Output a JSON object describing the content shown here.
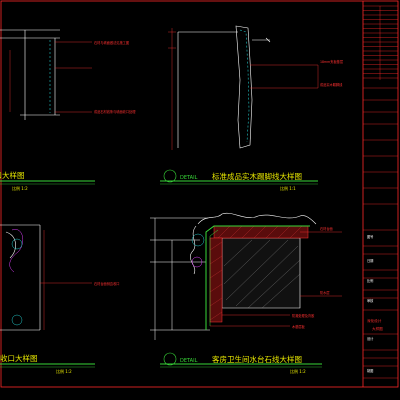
{
  "colors": {
    "background": "#000000",
    "frame": "#ff2a2a",
    "line": "#ffffff",
    "cyan": "#22c8c8",
    "green": "#38d838",
    "yellow": "#e8e800",
    "magenta": "#e040ff",
    "annotation": "#ff3030",
    "hatch_red": "#c83232"
  },
  "details": [
    {
      "title": "石材收口大样图",
      "scale": "比例  1:2"
    },
    {
      "badge": "DETAIL",
      "title": "标准成品实木踢脚线大样图",
      "scale": "比例  1:1"
    },
    {
      "title": "台面石材收口大样图",
      "scale": "比例  1:2"
    },
    {
      "badge": "DETAIL",
      "title": "客房卫生间水台石线大样图",
      "scale": "比例  1:2"
    }
  ],
  "annotations": {
    "top_left": [
      "石材与墙面做法见施工图",
      "成品石材线条与墙面收口处理"
    ],
    "top_mid": [
      "18mm夹板基层",
      "成品实木踢脚线"
    ],
    "mid_left": [
      "石材台面侧边收口"
    ],
    "bottom_mid": [
      "石材台面",
      "防水层",
      "防潮处理及背胶",
      "木基层板"
    ]
  },
  "title_block": {
    "rows": [
      "图号",
      "日期",
      "比例",
      "审核",
      "设计",
      "制图"
    ],
    "stamp": "深化设计",
    "sheet": "大样图"
  }
}
